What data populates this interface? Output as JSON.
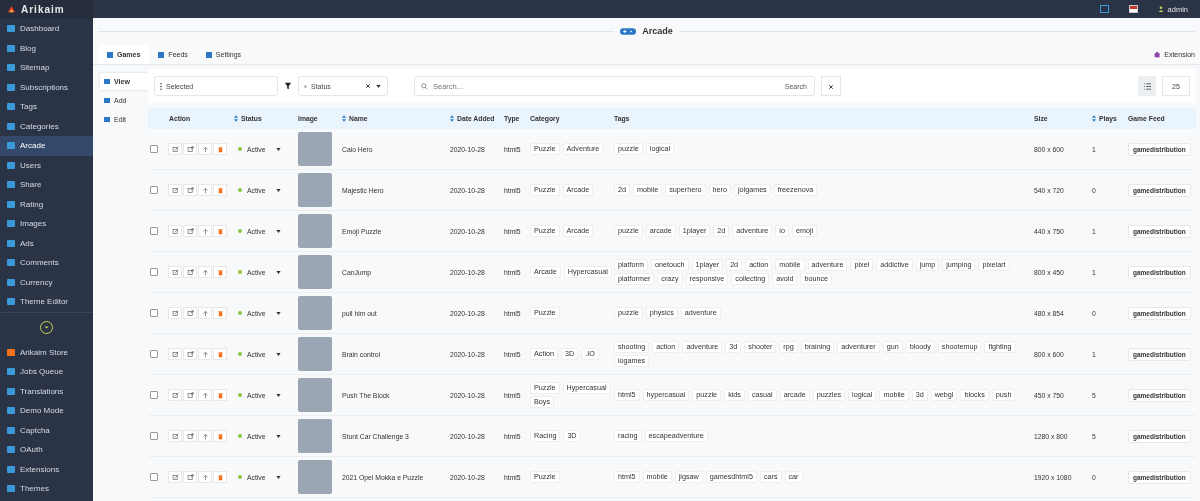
{
  "app": {
    "logo": "Arikaim"
  },
  "sidebar": {
    "groups": [
      [
        {
          "label": "Dashboard",
          "selected": false
        },
        {
          "label": "Blog",
          "selected": false
        },
        {
          "label": "Sitemap",
          "selected": false
        },
        {
          "label": "Subscriptions",
          "selected": false
        },
        {
          "label": "Tags",
          "selected": false
        },
        {
          "label": "Categories",
          "selected": false
        },
        {
          "label": "Arcade",
          "selected": true
        },
        {
          "label": "Users",
          "selected": false
        },
        {
          "label": "Share",
          "selected": false
        },
        {
          "label": "Rating",
          "selected": false
        },
        {
          "label": "Images",
          "selected": false
        },
        {
          "label": "Ads",
          "selected": false
        },
        {
          "label": "Comments",
          "selected": false
        },
        {
          "label": "Currency",
          "selected": false
        },
        {
          "label": "Theme Editor",
          "selected": false
        }
      ],
      [
        {
          "label": "Arikaim Store",
          "selected": false
        },
        {
          "label": "Jobs Queue",
          "selected": false
        },
        {
          "label": "Translations",
          "selected": false
        },
        {
          "label": "Demo Mode",
          "selected": false
        },
        {
          "label": "Captcha",
          "selected": false
        },
        {
          "label": "OAuth",
          "selected": false
        },
        {
          "label": "Extensions",
          "selected": false
        },
        {
          "label": "Themes",
          "selected": false
        }
      ]
    ]
  },
  "top_bar": {
    "user": "admin"
  },
  "page": {
    "title": "Arcade"
  },
  "tabs": [
    {
      "label": "Games",
      "selected": true
    },
    {
      "label": "Feeds",
      "selected": false
    },
    {
      "label": "Settings",
      "selected": false
    }
  ],
  "extension_link": "Extension",
  "side_menu": [
    {
      "label": "View",
      "selected": true
    },
    {
      "label": "Add",
      "selected": false
    },
    {
      "label": "Edit",
      "selected": false
    }
  ],
  "toolbar": {
    "selected_dropdown": "Selected",
    "status_filter": "Status",
    "search_placeholder": "Search...",
    "search_button": "Search",
    "page_size": "25"
  },
  "table": {
    "columns": [
      {
        "label": "Action",
        "sortable": false
      },
      {
        "label": "Status",
        "sortable": true
      },
      {
        "label": "Image",
        "sortable": false
      },
      {
        "label": "Name",
        "sortable": true
      },
      {
        "label": "Date Added",
        "sortable": true
      },
      {
        "label": "Type",
        "sortable": false
      },
      {
        "label": "Category",
        "sortable": false
      },
      {
        "label": "Tags",
        "sortable": false
      },
      {
        "label": "Size",
        "sortable": false
      },
      {
        "label": "Plays",
        "sortable": true
      },
      {
        "label": "Game Feed",
        "sortable": false
      }
    ],
    "rows": [
      {
        "checked": false,
        "status": "Active",
        "name": "Caio Hero",
        "date": "2020-10-28",
        "type": "html5",
        "categories": [
          "Puzzle",
          "Adventure"
        ],
        "tags": [
          "puzzle",
          "logical"
        ],
        "size": "800 x 600",
        "plays": "1",
        "feed": "gamedistribution"
      },
      {
        "checked": false,
        "status": "Active",
        "name": "Majestic Hero",
        "date": "2020-10-28",
        "type": "html5",
        "categories": [
          "Puzzle",
          "Arcade"
        ],
        "tags": [
          "2d",
          "mobile",
          "superhero",
          "hero",
          "jolgames",
          "freezenova"
        ],
        "size": "540 x 720",
        "plays": "0",
        "feed": "gamedistribution"
      },
      {
        "checked": false,
        "status": "Active",
        "name": "Emoji Puzzle",
        "date": "2020-10-28",
        "type": "html5",
        "categories": [
          "Puzzle",
          "Arcade"
        ],
        "tags": [
          "puzzle",
          "arcade",
          "1player",
          "2d",
          "adventure",
          "io",
          "emoji"
        ],
        "size": "440 x 750",
        "plays": "1",
        "feed": "gamedistribution"
      },
      {
        "checked": false,
        "status": "Active",
        "name": "CanJump",
        "date": "2020-10-28",
        "type": "html5",
        "categories": [
          "Arcade",
          "Hypercasual"
        ],
        "tags": [
          "platform",
          "onetouch",
          "1player",
          "2d",
          "action",
          "mobile",
          "adventure",
          "pixel",
          "addictive",
          "jump",
          "jumping",
          "pixelart",
          "platformer",
          "crazy",
          "responsive",
          "collecting",
          "avoid",
          "bounce"
        ],
        "size": "800 x 450",
        "plays": "1",
        "feed": "gamedistribution"
      },
      {
        "checked": false,
        "status": "Active",
        "name": "pull him out",
        "date": "2020-10-28",
        "type": "html5",
        "categories": [
          "Puzzle"
        ],
        "tags": [
          "puzzle",
          "physics",
          "adventure"
        ],
        "size": "480 x 854",
        "plays": "0",
        "feed": "gamedistribution"
      },
      {
        "checked": false,
        "status": "Active",
        "name": "Brain control",
        "date": "2020-10-28",
        "type": "html5",
        "categories": [
          "Action",
          "3D",
          ".IO"
        ],
        "tags": [
          "shooting",
          "action",
          "adventure",
          "3d",
          "shooter",
          "rpg",
          "braining",
          "adventurer",
          "gun",
          "bloody",
          "shootemup",
          "fighting",
          "iogames"
        ],
        "size": "800 x 600",
        "plays": "1",
        "feed": "gamedistribution"
      },
      {
        "checked": false,
        "status": "Active",
        "name": "Push The Block",
        "date": "2020-10-28",
        "type": "html5",
        "categories": [
          "Puzzle",
          "Hypercasual",
          "Boys"
        ],
        "tags": [
          "html5",
          "hypercasual",
          "puzzle",
          "kids",
          "casual",
          "arcade",
          "puzzles",
          "logical",
          "mobile",
          "3d",
          "webgl",
          "blocks",
          "push"
        ],
        "size": "450 x 750",
        "plays": "5",
        "feed": "gamedistribution"
      },
      {
        "checked": false,
        "status": "Active",
        "name": "Stunt Car Challenge 3",
        "date": "2020-10-28",
        "type": "html5",
        "categories": [
          "Racing",
          "3D"
        ],
        "tags": [
          "racing",
          "escapeadventure"
        ],
        "size": "1280 x 800",
        "plays": "5",
        "feed": "gamedistribution"
      },
      {
        "checked": false,
        "status": "Active",
        "name": "2021 Opel Mokka e Puzzle",
        "date": "2020-10-28",
        "type": "html5",
        "categories": [
          "Puzzle"
        ],
        "tags": [
          "html5",
          "mobile",
          "jigsaw",
          "gamesdhtml5",
          "cars",
          "car"
        ],
        "size": "1920 x 1080",
        "plays": "0",
        "feed": "gamedistribution"
      }
    ]
  }
}
